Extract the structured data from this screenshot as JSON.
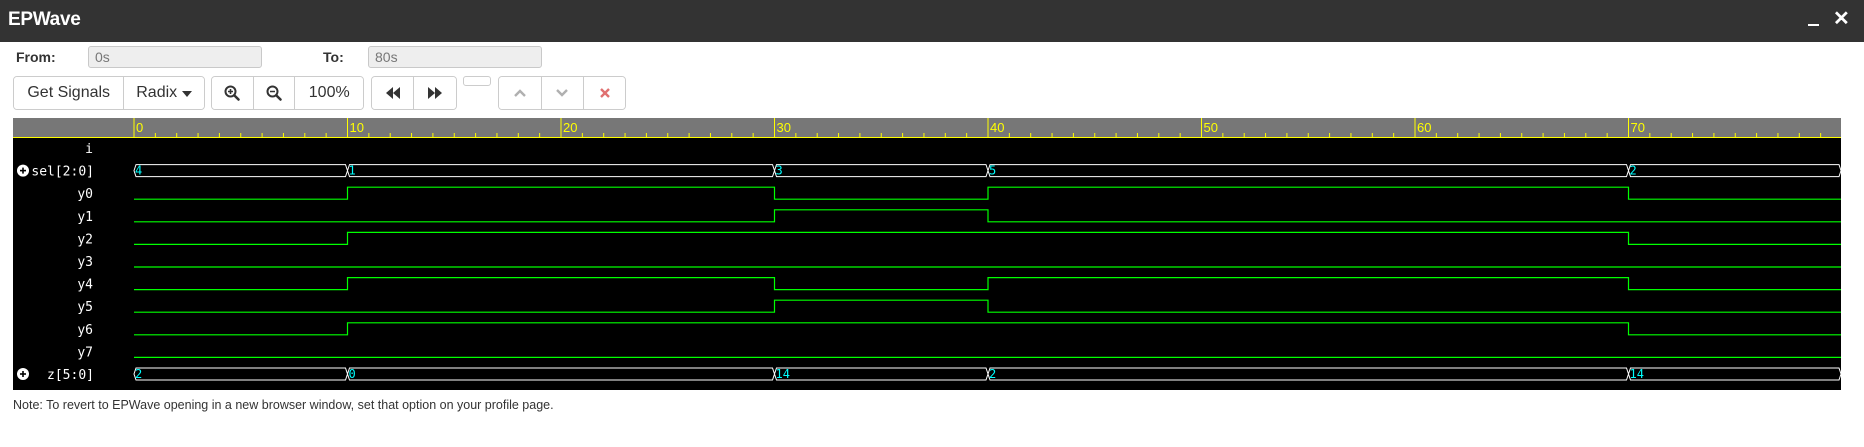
{
  "window": {
    "title": "EPWave",
    "close_glyph": "✕"
  },
  "range": {
    "from_label": "From:",
    "from_value": "0s",
    "to_label": "To:",
    "to_value": "80s"
  },
  "toolbar": {
    "get_signals_label": "Get Signals",
    "radix_label": "Radix",
    "zoom_level": "100%"
  },
  "icons": {
    "zoom_in": "zoom-in-icon",
    "zoom_out": "zoom-out-icon",
    "prev_transition": "fast-backward-icon",
    "next_transition": "fast-forward-icon",
    "move_up": "chevron-up-icon",
    "move_down": "chevron-down-icon",
    "delete": "x-icon",
    "expand": "plus-circle-icon"
  },
  "colors": {
    "ruler_label": "#ffff00",
    "wave_bit": "#00ff00",
    "wave_bus": "#ffffff",
    "bus_value": "#00ffff",
    "background": "#000000"
  },
  "time": {
    "start": 0,
    "end": 80,
    "major_ticks": [
      "0",
      "10",
      "20",
      "30",
      "40",
      "50",
      "60",
      "70"
    ]
  },
  "signals": [
    {
      "name": "i",
      "type": "bit",
      "expandable": false,
      "values": []
    },
    {
      "name": "sel[2:0]",
      "type": "bus",
      "expandable": true,
      "values": [
        [
          0,
          "4"
        ],
        [
          10,
          "1"
        ],
        [
          30,
          "3"
        ],
        [
          40,
          "5"
        ],
        [
          70,
          "2"
        ]
      ]
    },
    {
      "name": "y0",
      "type": "bit",
      "expandable": false,
      "values": [
        [
          0,
          0
        ],
        [
          10,
          1
        ],
        [
          30,
          0
        ],
        [
          40,
          1
        ],
        [
          70,
          0
        ]
      ]
    },
    {
      "name": "y1",
      "type": "bit",
      "expandable": false,
      "values": [
        [
          0,
          0
        ],
        [
          30,
          1
        ],
        [
          40,
          0
        ]
      ]
    },
    {
      "name": "y2",
      "type": "bit",
      "expandable": false,
      "values": [
        [
          0,
          0
        ],
        [
          10,
          1
        ],
        [
          70,
          0
        ]
      ]
    },
    {
      "name": "y3",
      "type": "bit",
      "expandable": false,
      "values": [
        [
          0,
          0
        ]
      ]
    },
    {
      "name": "y4",
      "type": "bit",
      "expandable": false,
      "values": [
        [
          0,
          0
        ],
        [
          10,
          1
        ],
        [
          30,
          0
        ],
        [
          40,
          1
        ],
        [
          70,
          0
        ]
      ]
    },
    {
      "name": "y5",
      "type": "bit",
      "expandable": false,
      "values": [
        [
          0,
          0
        ],
        [
          30,
          1
        ],
        [
          40,
          0
        ]
      ]
    },
    {
      "name": "y6",
      "type": "bit",
      "expandable": false,
      "values": [
        [
          0,
          0
        ],
        [
          10,
          1
        ],
        [
          70,
          0
        ]
      ]
    },
    {
      "name": "y7",
      "type": "bit",
      "expandable": false,
      "values": [
        [
          0,
          0
        ]
      ]
    },
    {
      "name": "z[5:0]",
      "type": "bus",
      "expandable": true,
      "values": [
        [
          0,
          "2"
        ],
        [
          10,
          "0"
        ],
        [
          30,
          "14"
        ],
        [
          40,
          "2"
        ],
        [
          70,
          "14"
        ]
      ]
    }
  ],
  "note": "Note: To revert to EPWave opening in a new browser window, set that option on your profile page."
}
